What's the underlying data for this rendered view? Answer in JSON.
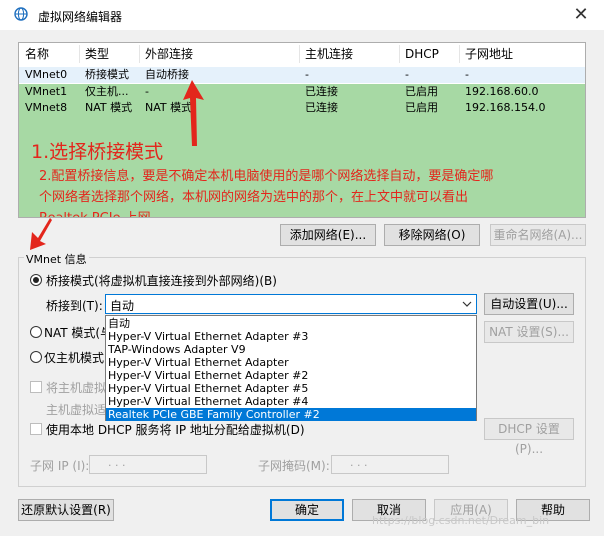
{
  "window": {
    "title": "虚拟网络编辑器",
    "close_glyph": "✕"
  },
  "table": {
    "columns": [
      "名称",
      "类型",
      "外部连接",
      "主机连接",
      "DHCP",
      "子网地址"
    ],
    "rows": [
      [
        "VMnet0",
        "桥接模式",
        "自动桥接",
        "-",
        "-",
        "-"
      ],
      [
        "VMnet1",
        "仅主机...",
        "-",
        "已连接",
        "已启用",
        "192.168.60.0"
      ],
      [
        "VMnet8",
        "NAT 模式",
        "NAT 模式",
        "已连接",
        "已启用",
        "192.168.154.0"
      ]
    ]
  },
  "annotation": {
    "step1": "1.选择桥接模式",
    "step2_line1": "2.配置桥接信息，要是不确定本机电脑使用的是哪个网络选择自动，要是确定哪",
    "step2_line2": "个网络者选择那个网络，本机网的网络为选中的那个，在上文中就可以看出",
    "step2_line3": "Realtek PCIe 上网。",
    "arrow_color": "#e3261c"
  },
  "list_buttons": {
    "add": "添加网络(E)...",
    "remove": "移除网络(O)",
    "rename": "重命名网络(A)..."
  },
  "vmnet_info": {
    "legend": "VMnet 信息",
    "bridge_radio": "桥接模式(将虚拟机直接连接到外部网络)(B)",
    "bridge_to_label": "桥接到(T):",
    "bridge_to_value": "自动",
    "auto_settings": "自动设置(U)...",
    "nat_radio": "NAT 模式(与",
    "nat_settings": "NAT 设置(S)...",
    "host_only_radio": "仅主机模式",
    "connect_host_chk": "将主机虚拟",
    "host_adapter_text": "主机虚拟适",
    "dhcp_chk": "使用本地 DHCP 服务将 IP 地址分配给虚拟机(D)",
    "dhcp_settings": "DHCP 设置(P)...",
    "subnet_ip_label": "子网 IP (I):",
    "subnet_mask_label": "子网掩码(M):",
    "ip_dots": ".       .       ."
  },
  "dropdown_options": [
    "自动",
    "Hyper-V Virtual Ethernet Adapter #3",
    "TAP-Windows Adapter V9",
    "Hyper-V Virtual Ethernet Adapter",
    "Hyper-V Virtual Ethernet Adapter #2",
    "Hyper-V Virtual Ethernet Adapter #5",
    "Hyper-V Virtual Ethernet Adapter #4",
    "Realtek PCIe GBE Family Controller #2"
  ],
  "footer": {
    "restore": "还原默认设置(R)",
    "ok": "确定",
    "cancel": "取消",
    "apply": "应用(A)",
    "help": "帮助"
  },
  "watermark": "https://blog.csdn.net/Dream_bin"
}
